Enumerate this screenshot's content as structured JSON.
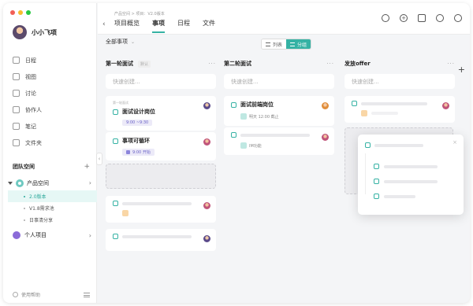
{
  "sidebar": {
    "profile_name": "小小飞项",
    "nav": [
      {
        "label": "日程",
        "icon": "calendar-icon"
      },
      {
        "label": "视图",
        "icon": "view-icon"
      },
      {
        "label": "讨论",
        "icon": "discussion-icon"
      },
      {
        "label": "协作人",
        "icon": "collaborators-icon"
      },
      {
        "label": "笔记",
        "icon": "note-icon"
      },
      {
        "label": "文件夹",
        "icon": "folder-icon"
      }
    ],
    "team_space_label": "团队空间",
    "product_space_label": "产品空间",
    "sub_items": [
      "2.0版本",
      "V1.8需求池",
      "日事清分享"
    ],
    "personal_label": "个人项目",
    "help_label": "使用帮助"
  },
  "header": {
    "breadcrumb": "产品空间 > 项目：V2.0版本",
    "tabs": [
      "项目概览",
      "事项",
      "日程",
      "文件"
    ],
    "active_tab": "事项"
  },
  "toolbar": {
    "filter_label": "全部事项",
    "view_list": "列表",
    "view_group": "分组"
  },
  "columns": [
    {
      "title": "第一轮面试",
      "tag": "默认",
      "quick_create": "快速创建..."
    },
    {
      "title": "第二轮面试",
      "quick_create": "快速创建..."
    },
    {
      "title": "发放offer",
      "quick_create": "快速创建..."
    }
  ],
  "cards": {
    "c1_breadcrumb": "第一轮面试",
    "c1_title": "面试设计岗位",
    "c1_time": "9:00 ~9:30",
    "c2_title": "事项可循环",
    "c2_time": "9:00 开始",
    "c3_title": "面试前端岗位",
    "c3_time": "明天 12:00 截止",
    "c4_label": "IM功能"
  },
  "colors": {
    "accent": "#35b2a4",
    "chip_purple": "#6b63c7"
  }
}
